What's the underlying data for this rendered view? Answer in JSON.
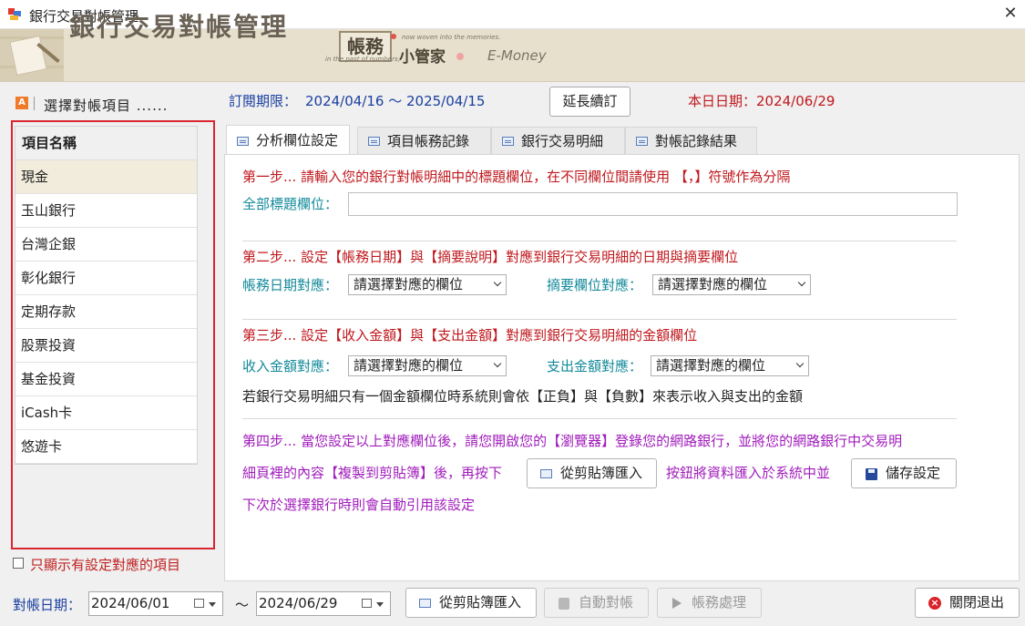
{
  "window": {
    "title": "銀行交易對帳管理",
    "close_glyph": "✕"
  },
  "banner": {
    "title": "銀行交易對帳管理",
    "brand_1": "帳務",
    "brand_2": "小管家",
    "brand_3": "E-Money",
    "tagline_1": "in the past of numbers,",
    "tagline_2": "now woven into the memories."
  },
  "left": {
    "badge": "A",
    "header": "選擇對帳項目 ......",
    "list_header": "項目名稱",
    "items": [
      "現金",
      "玉山銀行",
      "台灣企銀",
      "彰化銀行",
      "定期存款",
      "股票投資",
      "基金投資",
      "iCash卡",
      "悠遊卡"
    ],
    "selected_index": 0,
    "only_configured_label": "只顯示有設定對應的項目",
    "only_configured_checked": false
  },
  "subscription": {
    "label": "訂閱期限：",
    "range": "2024/04/16 ～ 2025/04/15",
    "extend_button": "延長續訂",
    "today": "本日日期：2024/06/29"
  },
  "tabs": [
    {
      "label": "分析欄位設定",
      "active": true
    },
    {
      "label": "項目帳務記錄",
      "active": false
    },
    {
      "label": "銀行交易明細",
      "active": false
    },
    {
      "label": "對帳記錄結果",
      "active": false
    }
  ],
  "panel": {
    "step1": "第一步... 請輸入您的銀行對帳明細中的標題欄位，在不同欄位間請使用 【，】符號作為分隔",
    "all_fields_label": "全部標題欄位：",
    "all_fields_value": "",
    "step2": "第二步... 設定【帳務日期】與【摘要說明】對應到銀行交易明細的日期與摘要欄位",
    "date_map_label": "帳務日期對應：",
    "summary_map_label": "摘要欄位對應：",
    "step3": "第三步... 設定【收入金額】與【支出金額】對應到銀行交易明細的金額欄位",
    "income_map_label": "收入金額對應：",
    "expense_map_label": "支出金額對應：",
    "select_placeholder": "請選擇對應的欄位",
    "note": "若銀行交易明細只有一個金額欄位時系統則會依【正負】與【負數】來表示收入與支出的金額",
    "step4_line1": "第四步... 當您設定以上對應欄位後，請您開啟您的【瀏覽器】登錄您的網路銀行，並將您的網路銀行中交易明",
    "step4_line2_a": "細頁裡的內容【複製到剪貼簿】後，再按下",
    "paste_button": "從剪貼簿匯入",
    "step4_line2_b": "按鈕將資料匯入於系統中並",
    "save_button": "儲存設定",
    "step4_line3": "下次於選擇銀行時則會自動引用該設定"
  },
  "bottom": {
    "date_label": "對帳日期：",
    "date_from": "2024/06/01",
    "tilde": "～",
    "date_to": "2024/06/29",
    "paste_button": "從剪貼簿匯入",
    "auto_button": "自動對帳",
    "process_button": "帳務處理",
    "exit_button": "關閉退出"
  },
  "colors": {
    "frame_highlight": "#d9262f",
    "blue_text": "#1a3fa0",
    "red_text": "#c0181d",
    "teal_text": "#138a9a",
    "purple_text": "#a01cbb"
  }
}
